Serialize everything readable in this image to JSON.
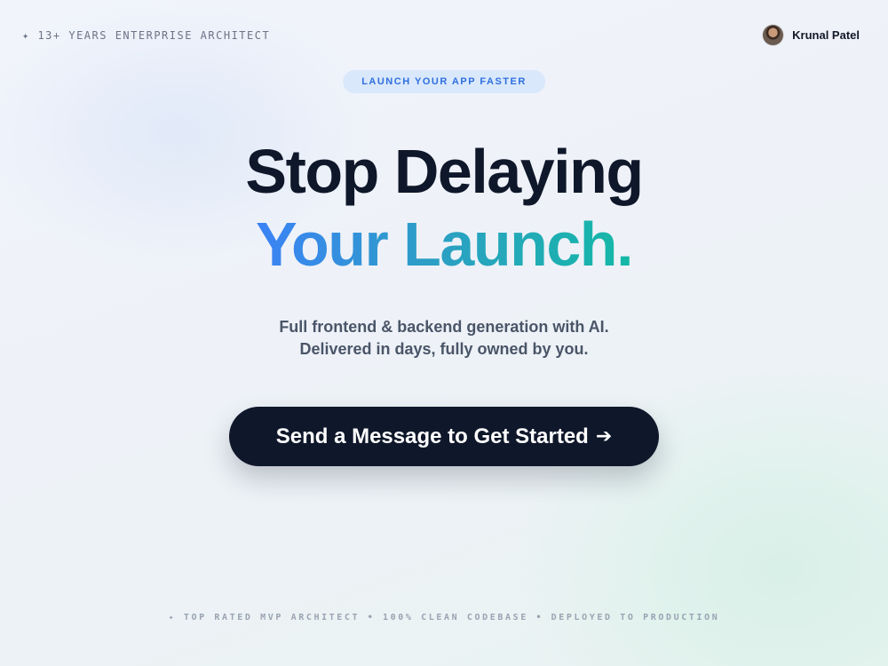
{
  "header": {
    "tagline": "✦ 13+ YEARS ENTERPRISE ARCHITECT",
    "profile_name": "Krunal Patel"
  },
  "hero": {
    "badge": "LAUNCH YOUR APP FASTER",
    "headline_line1": "Stop Delaying",
    "headline_line2": "Your Launch.",
    "subtitle_line1": "Full frontend & backend generation with AI.",
    "subtitle_line2": "Delivered in days, fully owned by you.",
    "cta_label": "Send a Message to Get Started",
    "cta_arrow": "➔"
  },
  "footer": {
    "tagline": "✦ TOP RATED MVP ARCHITECT • 100% CLEAN CODEBASE • DEPLOYED TO PRODUCTION"
  },
  "colors": {
    "primary_dark": "#0f172a",
    "gradient_start": "#3b82f6",
    "gradient_end": "#14b8a6",
    "badge_bg": "#d9e8fb",
    "badge_text": "#2f6fdf"
  },
  "icons": {
    "avatar": "profile-photo"
  }
}
